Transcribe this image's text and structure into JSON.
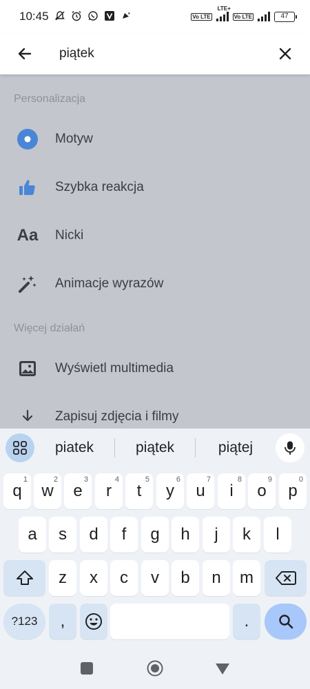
{
  "status_bar": {
    "time": "10:45",
    "battery": "47",
    "network_label": "LTE+",
    "volte_label": "Vo LTE",
    "icons": [
      "muted-notifications-icon",
      "alarm-icon",
      "whatsapp-icon",
      "v-app-icon",
      "notification-bell-icon"
    ]
  },
  "search": {
    "query": "piątek"
  },
  "sections": [
    {
      "header": "Personalizacja",
      "items": [
        {
          "label": "Motyw",
          "icon": "theme-icon"
        },
        {
          "label": "Szybka reakcja",
          "icon": "thumbs-up-icon"
        },
        {
          "label": "Nicki",
          "icon": "text-aa-icon"
        },
        {
          "label": "Animacje wyrazów",
          "icon": "magic-wand-icon"
        }
      ]
    },
    {
      "header": "Więcej działań",
      "items": [
        {
          "label": "Wyświetl multimedia",
          "icon": "image-icon"
        },
        {
          "label": "Zapisuj zdjęcia i filmy",
          "icon": "download-icon"
        }
      ]
    }
  ],
  "icon_text": {
    "aa": "Aa"
  },
  "keyboard": {
    "suggestions": [
      "piatek",
      "piątek",
      "piątej"
    ],
    "row1": [
      {
        "letter": "q",
        "hint": "1"
      },
      {
        "letter": "w",
        "hint": "2"
      },
      {
        "letter": "e",
        "hint": "3"
      },
      {
        "letter": "r",
        "hint": "4"
      },
      {
        "letter": "t",
        "hint": "5"
      },
      {
        "letter": "y",
        "hint": "6"
      },
      {
        "letter": "u",
        "hint": "7"
      },
      {
        "letter": "i",
        "hint": "8"
      },
      {
        "letter": "o",
        "hint": "9"
      },
      {
        "letter": "p",
        "hint": "0"
      }
    ],
    "row2": [
      "a",
      "s",
      "d",
      "f",
      "g",
      "h",
      "j",
      "k",
      "l"
    ],
    "row3": [
      "z",
      "x",
      "c",
      "v",
      "b",
      "n",
      "m"
    ],
    "symbols_label": "?123",
    "comma_label": ",",
    "period_label": "."
  },
  "colors": {
    "accent": "#4a86d6",
    "dim_overlay": "#c3c6cc",
    "keyboard_bg": "#eef2f7",
    "action_key": "#a8c7fa"
  }
}
